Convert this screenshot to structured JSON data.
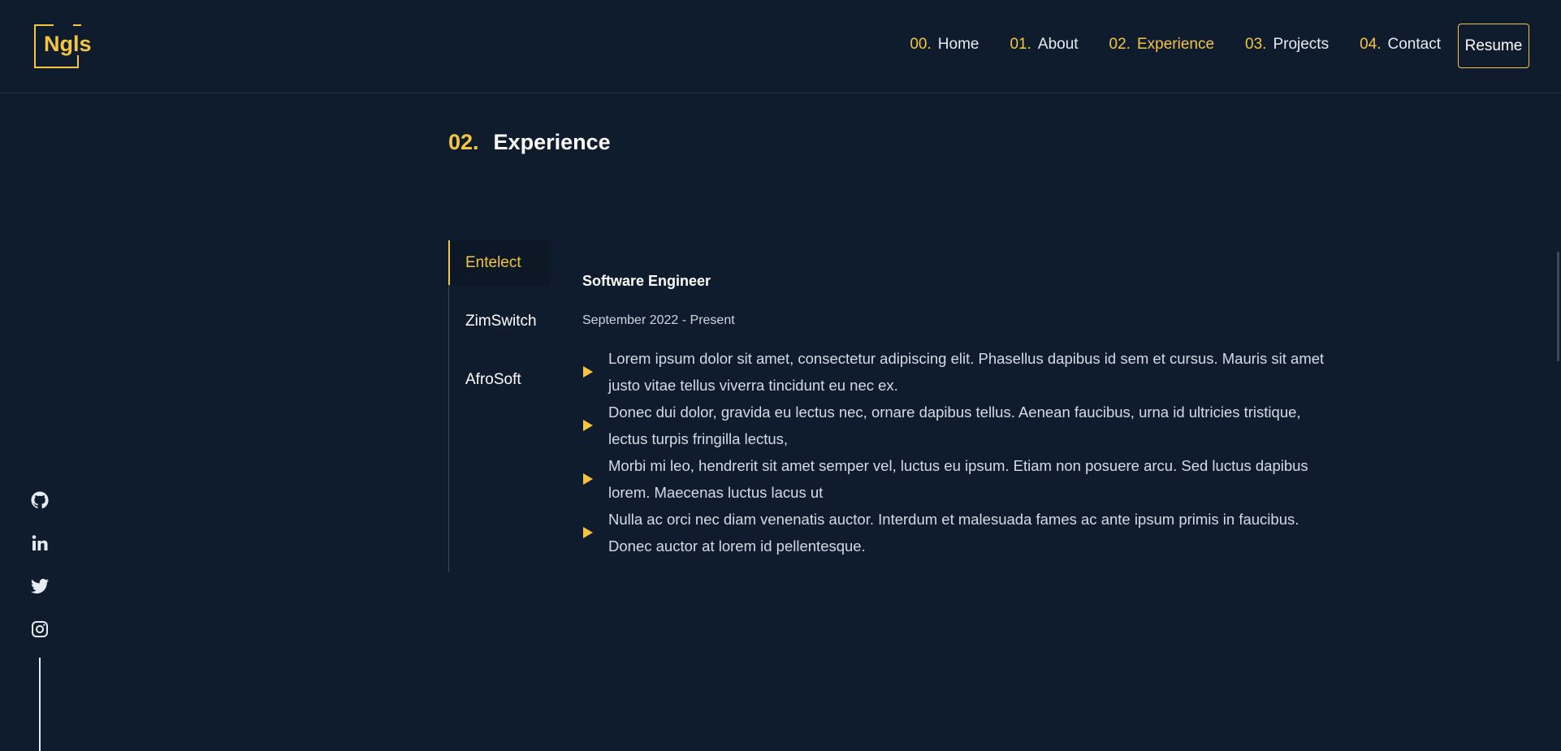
{
  "logo": {
    "text": "Ngls"
  },
  "nav": {
    "items": [
      {
        "num": "00.",
        "label": "Home"
      },
      {
        "num": "01.",
        "label": "About"
      },
      {
        "num": "02.",
        "label": "Experience"
      },
      {
        "num": "03.",
        "label": "Projects"
      },
      {
        "num": "04.",
        "label": "Contact"
      }
    ],
    "active": "Experience",
    "resume_label": "Resume"
  },
  "section": {
    "num": "02.",
    "title": "Experience"
  },
  "tabs": [
    {
      "label": "Entelect",
      "active": true
    },
    {
      "label": "ZimSwitch",
      "active": false
    },
    {
      "label": "AfroSoft",
      "active": false
    }
  ],
  "job": {
    "title": "Software Engineer",
    "dates": "September 2022 - Present",
    "bullets": [
      "Lorem ipsum dolor sit amet, consectetur adipiscing elit. Phasellus dapibus id sem et cursus. Mauris sit amet justo vitae tellus viverra tincidunt eu nec ex.",
      "Donec dui dolor, gravida eu lectus nec, ornare dapibus tellus. Aenean faucibus, urna id ultricies tristique, lectus turpis fringilla lectus,",
      "Morbi mi leo, hendrerit sit amet semper vel, luctus eu ipsum. Etiam non posuere arcu. Sed luctus dapibus lorem. Maecenas luctus lacus ut",
      "Nulla ac orci nec diam venenatis auctor. Interdum et malesuada fames ac ante ipsum primis in faucibus. Donec auctor at lorem id pellentesque."
    ]
  },
  "social": [
    "github-icon",
    "linkedin-icon",
    "twitter-icon",
    "instagram-icon"
  ],
  "colors": {
    "background": "#0f1c2e",
    "accent": "#f5c542",
    "text": "#e6ebf2"
  }
}
